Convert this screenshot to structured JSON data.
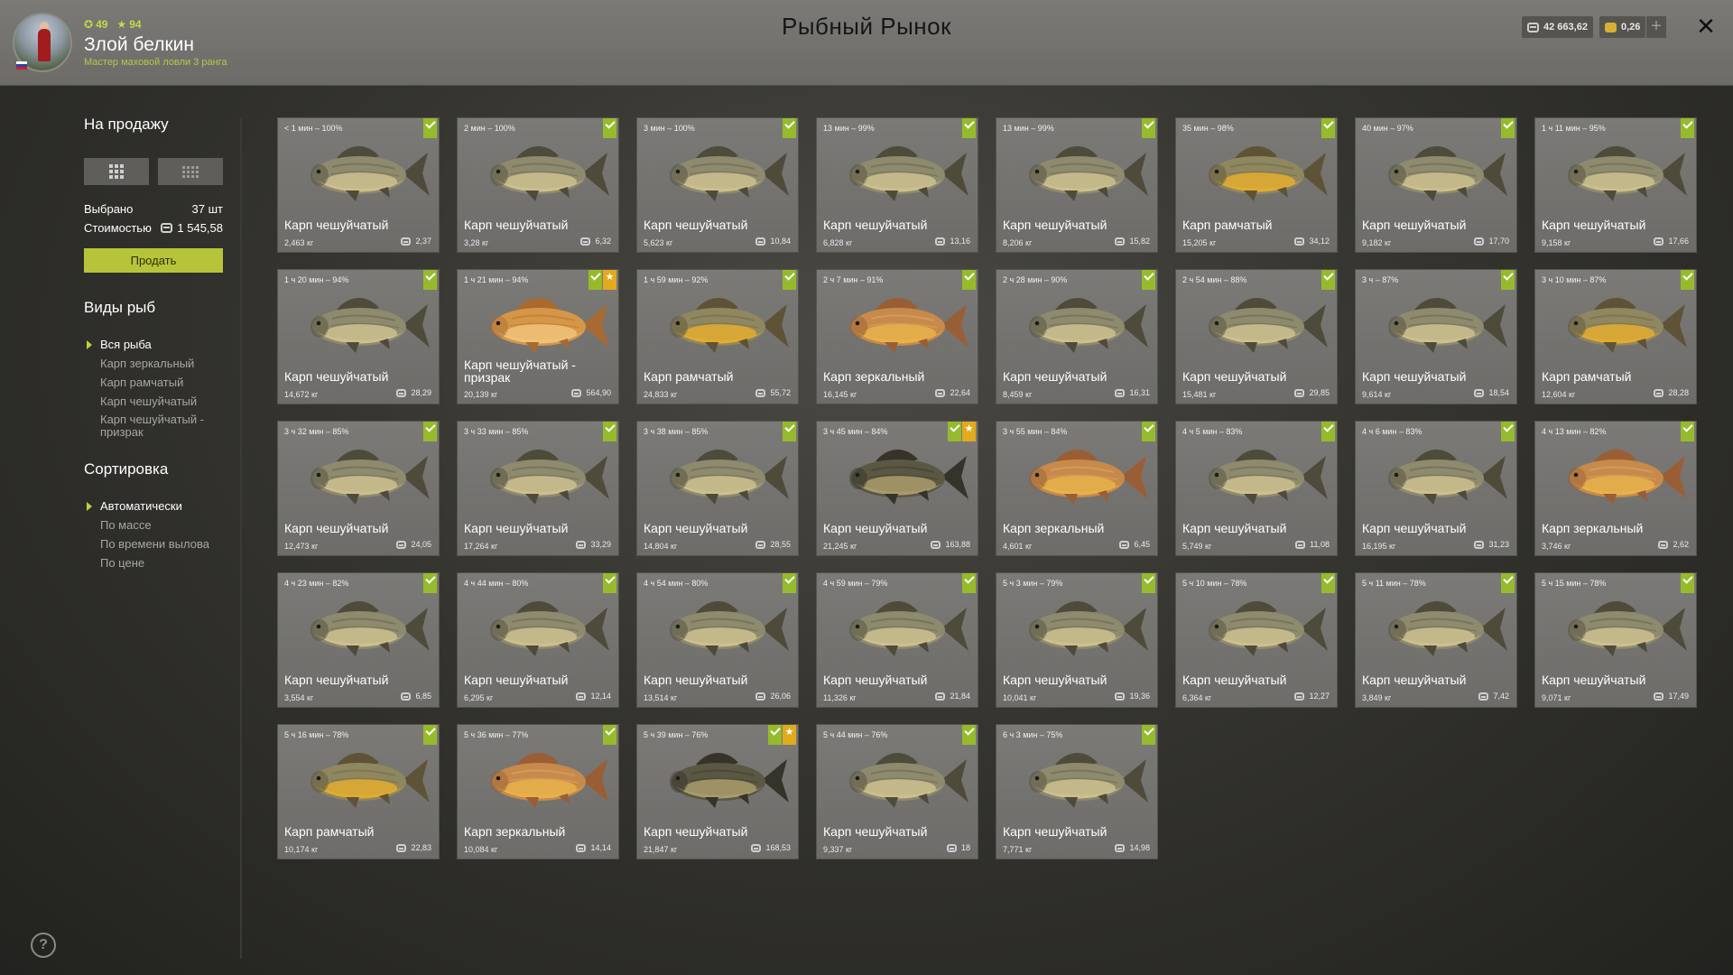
{
  "header": {
    "title": "Рыбный Рынок",
    "player": {
      "level": "49",
      "rating": "94",
      "name": "Злой белкин",
      "rank": "Мастер маховой ловли 3 ранга"
    },
    "silver": "42 663,62",
    "gold": "0,26",
    "plus": "+",
    "close": "✕"
  },
  "sidebar": {
    "sale_heading": "На продажу",
    "selected_label": "Выбрано",
    "selected_value": "37 шт",
    "cost_label": "Стоимостью",
    "cost_value": "1 545,58",
    "sell_button": "Продать",
    "fish_types_heading": "Виды рыб",
    "fish_types": [
      "Вся рыба",
      "Карп зеркальный",
      "Карп рамчатый",
      "Карп чешуйчатый",
      "Карп чешуйчатый - призрак"
    ],
    "sort_heading": "Сортировка",
    "sort_options": [
      "Автоматически",
      "По массе",
      "По времени вылова",
      "По цене"
    ],
    "help": "?"
  },
  "colors": {
    "accent": "#b7c43a",
    "check": "#95bb2c",
    "star": "#e2ab1d"
  },
  "cards": [
    {
      "time": "< 1 мин – 100%",
      "name": "Карп чешуйчатый",
      "weight": "2,463 кг",
      "price": "2,37",
      "type": "common",
      "trophy": false
    },
    {
      "time": "2 мин – 100%",
      "name": "Карп чешуйчатый",
      "weight": "3,28 кг",
      "price": "6,32",
      "type": "common",
      "trophy": false
    },
    {
      "time": "3 мин – 100%",
      "name": "Карп чешуйчатый",
      "weight": "5,623 кг",
      "price": "10,84",
      "type": "common",
      "trophy": false
    },
    {
      "time": "13 мин – 99%",
      "name": "Карп чешуйчатый",
      "weight": "6,828 кг",
      "price": "13,16",
      "type": "common",
      "trophy": false
    },
    {
      "time": "13 мин – 99%",
      "name": "Карп чешуйчатый",
      "weight": "8,206 кг",
      "price": "15,82",
      "type": "common",
      "trophy": false
    },
    {
      "time": "35 мин – 98%",
      "name": "Карп рамчатый",
      "weight": "15,205 кг",
      "price": "34,12",
      "type": "frame",
      "trophy": false
    },
    {
      "time": "40 мин – 97%",
      "name": "Карп чешуйчатый",
      "weight": "9,182 кг",
      "price": "17,70",
      "type": "common",
      "trophy": false
    },
    {
      "time": "1 ч 11 мин – 95%",
      "name": "Карп чешуйчатый",
      "weight": "9,158 кг",
      "price": "17,66",
      "type": "common",
      "trophy": false
    },
    {
      "time": "1 ч 20 мин – 94%",
      "name": "Карп чешуйчатый",
      "weight": "14,672 кг",
      "price": "28,29",
      "type": "common",
      "trophy": false
    },
    {
      "time": "1 ч 21 мин – 94%",
      "name": "Карп чешуйчатый - призрак",
      "weight": "20,139 кг",
      "price": "564,90",
      "type": "ghost",
      "trophy": true
    },
    {
      "time": "1 ч 59 мин – 92%",
      "name": "Карп рамчатый",
      "weight": "24,833 кг",
      "price": "55,72",
      "type": "frame",
      "trophy": false
    },
    {
      "time": "2 ч 7 мин – 91%",
      "name": "Карп зеркальный",
      "weight": "16,145 кг",
      "price": "22,64",
      "type": "mirror",
      "trophy": false
    },
    {
      "time": "2 ч 28 мин – 90%",
      "name": "Карп чешуйчатый",
      "weight": "8,459 кг",
      "price": "16,31",
      "type": "common",
      "trophy": false
    },
    {
      "time": "2 ч 54 мин – 88%",
      "name": "Карп чешуйчатый",
      "weight": "15,481 кг",
      "price": "29,85",
      "type": "common",
      "trophy": false
    },
    {
      "time": "3 ч – 87%",
      "name": "Карп чешуйчатый",
      "weight": "9,614 кг",
      "price": "18,54",
      "type": "common",
      "trophy": false
    },
    {
      "time": "3 ч 10 мин – 87%",
      "name": "Карп рамчатый",
      "weight": "12,604 кг",
      "price": "28,28",
      "type": "frame",
      "trophy": false
    },
    {
      "time": "3 ч 32 мин – 85%",
      "name": "Карп чешуйчатый",
      "weight": "12,473 кг",
      "price": "24,05",
      "type": "common",
      "trophy": false
    },
    {
      "time": "3 ч 33 мин – 85%",
      "name": "Карп чешуйчатый",
      "weight": "17,264 кг",
      "price": "33,29",
      "type": "common",
      "trophy": false
    },
    {
      "time": "3 ч 38 мин – 85%",
      "name": "Карп чешуйчатый",
      "weight": "14,804 кг",
      "price": "28,55",
      "type": "common",
      "trophy": false
    },
    {
      "time": "3 ч 45 мин – 84%",
      "name": "Карп чешуйчатый",
      "weight": "21,245 кг",
      "price": "163,88",
      "type": "dark",
      "trophy": true
    },
    {
      "time": "3 ч 55 мин – 84%",
      "name": "Карп зеркальный",
      "weight": "4,601 кг",
      "price": "6,45",
      "type": "mirror",
      "trophy": false
    },
    {
      "time": "4 ч 5 мин – 83%",
      "name": "Карп чешуйчатый",
      "weight": "5,749 кг",
      "price": "11,08",
      "type": "common",
      "trophy": false
    },
    {
      "time": "4 ч 6 мин – 83%",
      "name": "Карп чешуйчатый",
      "weight": "16,195 кг",
      "price": "31,23",
      "type": "common",
      "trophy": false
    },
    {
      "time": "4 ч 13 мин – 82%",
      "name": "Карп зеркальный",
      "weight": "3,746 кг",
      "price": "2,62",
      "type": "mirror",
      "trophy": false
    },
    {
      "time": "4 ч 23 мин – 82%",
      "name": "Карп чешуйчатый",
      "weight": "3,554 кг",
      "price": "6,85",
      "type": "common",
      "trophy": false
    },
    {
      "time": "4 ч 44 мин – 80%",
      "name": "Карп чешуйчатый",
      "weight": "6,295 кг",
      "price": "12,14",
      "type": "common",
      "trophy": false
    },
    {
      "time": "4 ч 54 мин – 80%",
      "name": "Карп чешуйчатый",
      "weight": "13,514 кг",
      "price": "26,06",
      "type": "common",
      "trophy": false
    },
    {
      "time": "4 ч 59 мин – 79%",
      "name": "Карп чешуйчатый",
      "weight": "11,326 кг",
      "price": "21,84",
      "type": "common",
      "trophy": false
    },
    {
      "time": "5 ч 3 мин – 79%",
      "name": "Карп чешуйчатый",
      "weight": "10,041 кг",
      "price": "19,36",
      "type": "common",
      "trophy": false
    },
    {
      "time": "5 ч 10 мин – 78%",
      "name": "Карп чешуйчатый",
      "weight": "6,364 кг",
      "price": "12,27",
      "type": "common",
      "trophy": false
    },
    {
      "time": "5 ч 11 мин – 78%",
      "name": "Карп чешуйчатый",
      "weight": "3,849 кг",
      "price": "7,42",
      "type": "common",
      "trophy": false
    },
    {
      "time": "5 ч 15 мин – 78%",
      "name": "Карп чешуйчатый",
      "weight": "9,071 кг",
      "price": "17,49",
      "type": "common",
      "trophy": false
    },
    {
      "time": "5 ч 16 мин – 78%",
      "name": "Карп рамчатый",
      "weight": "10,174 кг",
      "price": "22,83",
      "type": "frame",
      "trophy": false
    },
    {
      "time": "5 ч 36 мин – 77%",
      "name": "Карп зеркальный",
      "weight": "10,084 кг",
      "price": "14,14",
      "type": "mirror",
      "trophy": false
    },
    {
      "time": "5 ч 39 мин – 76%",
      "name": "Карп чешуйчатый",
      "weight": "21,847 кг",
      "price": "168,53",
      "type": "dark",
      "trophy": true
    },
    {
      "time": "5 ч 44 мин – 76%",
      "name": "Карп чешуйчатый",
      "weight": "9,337 кг",
      "price": "18",
      "type": "common",
      "trophy": false
    },
    {
      "time": "6 ч 3 мин – 75%",
      "name": "Карп чешуйчатый",
      "weight": "7,771 кг",
      "price": "14,98",
      "type": "common",
      "trophy": false
    }
  ]
}
